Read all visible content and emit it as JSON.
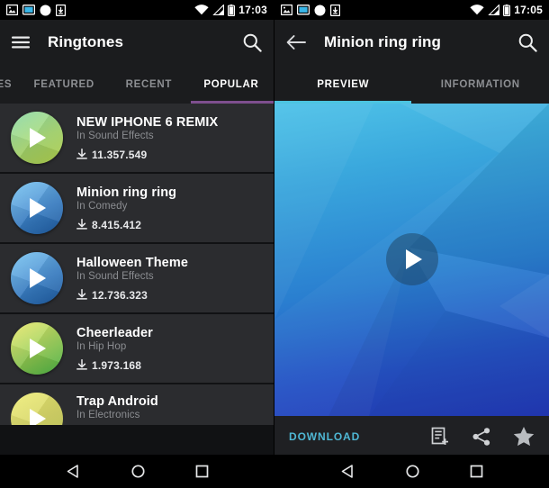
{
  "left": {
    "statusbar": {
      "time": "17:03",
      "icons": [
        "photo-icon",
        "cast-screen-icon",
        "circle-icon",
        "device-download-icon"
      ],
      "right_icons": [
        "wifi-icon",
        "signal-icon",
        "battery-icon"
      ]
    },
    "toolbar": {
      "menu_icon": "hamburger-menu-icon",
      "title": "Ringtones",
      "search_icon": "search-icon"
    },
    "tabs": [
      {
        "label": "ES",
        "active": false
      },
      {
        "label": "FEATURED",
        "active": false
      },
      {
        "label": "RECENT",
        "active": false
      },
      {
        "label": "POPULAR",
        "active": true
      }
    ],
    "tab_indicator_color": "#7e4f8e",
    "ringtones": [
      {
        "title": "NEW IPHONE 6 REMIX",
        "category": "In Sound Effects",
        "downloads": "11.357.549",
        "color_a": "#7fd3a0",
        "color_b": "#b9dd55"
      },
      {
        "title": "Minion ring ring",
        "category": "In Comedy",
        "downloads": "8.415.412",
        "color_a": "#63b6e8",
        "color_b": "#1f5fa8"
      },
      {
        "title": "Halloween Theme",
        "category": "In Sound Effects",
        "downloads": "12.736.323",
        "color_a": "#63b6e8",
        "color_b": "#1f5fa8"
      },
      {
        "title": "Cheerleader",
        "category": "In Hip Hop",
        "downloads": "1.973.168",
        "color_a": "#e4e45c",
        "color_b": "#4fbe4a"
      },
      {
        "title": "Trap Android",
        "category": "In Electronics",
        "downloads": "",
        "color_a": "#e4e45c",
        "color_b": "#c9cf55"
      }
    ]
  },
  "right": {
    "statusbar": {
      "time": "17:05",
      "icons": [
        "photo-icon",
        "cast-screen-icon",
        "circle-icon",
        "device-download-icon"
      ],
      "right_icons": [
        "wifi-icon",
        "signal-icon",
        "battery-icon"
      ]
    },
    "toolbar": {
      "back_icon": "back-arrow-icon",
      "title": "Minion ring ring",
      "search_icon": "search-icon"
    },
    "tabs": [
      {
        "label": "PREVIEW",
        "active": true
      },
      {
        "label": "INFORMATION",
        "active": false
      }
    ],
    "tab_indicator_color": "#4cc4e0",
    "preview": {
      "play_icon": "play-button-icon"
    },
    "actionbar": {
      "download_label": "DOWNLOAD",
      "download_color": "#4fb7d4",
      "icons": [
        "playlist-add-icon",
        "share-icon",
        "favorite-star-icon"
      ]
    }
  },
  "navbar": {
    "buttons": [
      "back-nav-icon",
      "home-nav-icon",
      "recents-nav-icon"
    ]
  }
}
